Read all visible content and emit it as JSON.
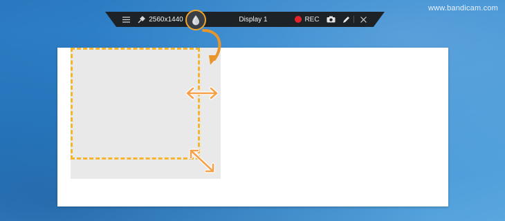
{
  "watermark": {
    "text": "www.bandicam.com"
  },
  "toolbar": {
    "menu_icon": "hamburger-icon",
    "pin_icon": "pin-icon",
    "resolution": "2560x1440",
    "mode_icon": "droplet-icon",
    "display_label": "Display 1",
    "rec_label": "REC",
    "camera_icon": "camera-icon",
    "pencil_icon": "pencil-icon",
    "close_icon": "close-icon"
  },
  "colors": {
    "accent": "#f5b42a",
    "rec": "#e3232a",
    "toolbar_bg": "#1d2227",
    "desktop_bg": "#2f86cf"
  }
}
